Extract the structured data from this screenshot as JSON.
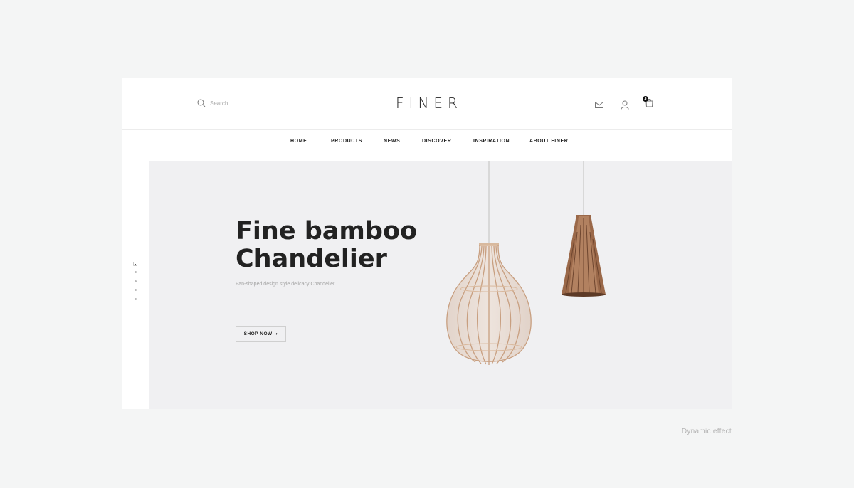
{
  "header": {
    "search_placeholder": "Search",
    "logo": "FINER",
    "cart_count": "3"
  },
  "nav": {
    "items": [
      "HOME",
      "PRODUCTS",
      "NEWS",
      "DISCOVER",
      "INSPIRATION",
      "ABOUT  FINER"
    ]
  },
  "hero": {
    "headline_line1": "Fine bamboo",
    "headline_line2": "Chandelier",
    "subtitle": "Fan-shaped design style delicacy Chandelier",
    "cta_label": "SHOP NOW",
    "cta_arrow": "›",
    "slide_count": 5,
    "active_slide": 1
  },
  "caption": "Dynamic effect",
  "colors": {
    "page_background": "#f4f5f5",
    "hero_background": "#f0f0f2",
    "text_dark": "#222222",
    "lamp_wood_light": "#d9b79b",
    "lamp_wood_dark": "#8a5a3e"
  },
  "icons": [
    "search-icon",
    "mail-icon",
    "user-icon",
    "cart-icon",
    "chevron-right-icon"
  ]
}
